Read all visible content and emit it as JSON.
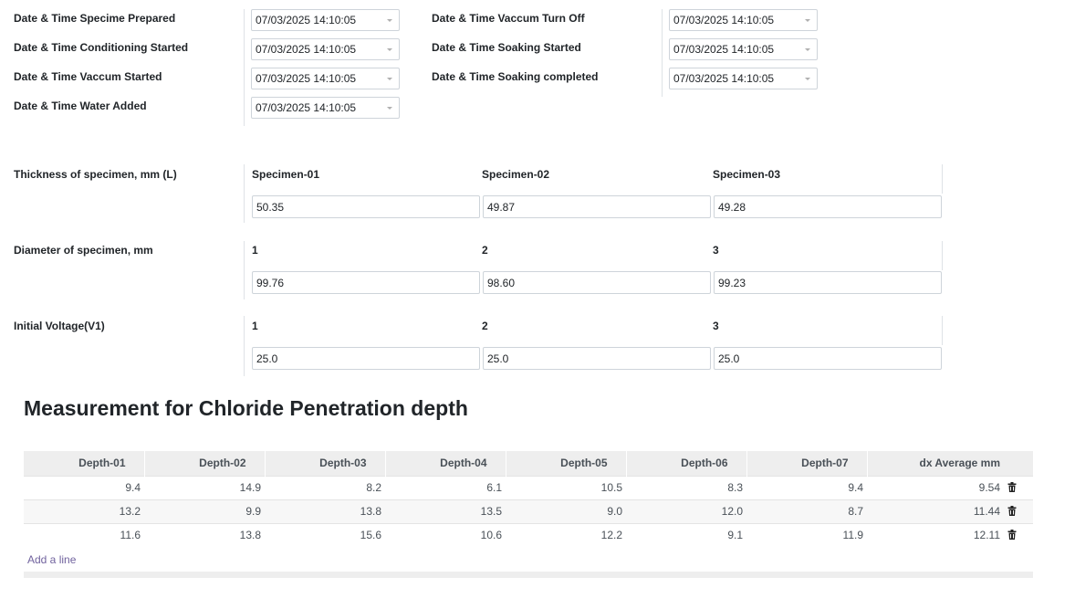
{
  "datetimes": {
    "left": [
      {
        "label": "Date & Time Specime Prepared",
        "value": "07/03/2025 14:10:05"
      },
      {
        "label": "Date & Time Conditioning Started",
        "value": "07/03/2025 14:10:05"
      },
      {
        "label": "Date & Time Vaccum Started",
        "value": "07/03/2025 14:10:05"
      },
      {
        "label": "Date & Time Water Added",
        "value": "07/03/2025 14:10:05"
      }
    ],
    "right": [
      {
        "label": "Date & Time Vaccum Turn Off",
        "value": "07/03/2025 14:10:05"
      },
      {
        "label": "Date & Time Soaking Started",
        "value": "07/03/2025 14:10:05"
      },
      {
        "label": "Date & Time Soaking completed",
        "value": "07/03/2025 14:10:05"
      }
    ]
  },
  "thickness": {
    "label": "Thickness of specimen, mm (L)",
    "headers": [
      "Specimen-01",
      "Specimen-02",
      "Specimen-03"
    ],
    "values": [
      "50.35",
      "49.87",
      "49.28"
    ]
  },
  "diameter": {
    "label": "Diameter of specimen, mm",
    "headers": [
      "1",
      "2",
      "3"
    ],
    "values": [
      "99.76",
      "98.60",
      "99.23"
    ]
  },
  "voltage": {
    "label": "Initial Voltage(V1)",
    "headers": [
      "1",
      "2",
      "3"
    ],
    "values": [
      "25.0",
      "25.0",
      "25.0"
    ]
  },
  "measurement": {
    "title": "Measurement for Chloride Penetration depth",
    "columns": [
      "Depth-01",
      "Depth-02",
      "Depth-03",
      "Depth-04",
      "Depth-05",
      "Depth-06",
      "Depth-07",
      "dx Average mm"
    ],
    "rows": [
      [
        "9.4",
        "14.9",
        "8.2",
        "6.1",
        "10.5",
        "8.3",
        "9.4",
        "9.54"
      ],
      [
        "13.2",
        "9.9",
        "13.8",
        "13.5",
        "9.0",
        "12.0",
        "8.7",
        "11.44"
      ],
      [
        "11.6",
        "13.8",
        "15.6",
        "10.6",
        "12.2",
        "9.1",
        "11.9",
        "12.11"
      ]
    ],
    "add_line": "Add a line"
  },
  "icons": {
    "row_delete": "trash-icon",
    "dropdown": "caret-down-icon"
  }
}
